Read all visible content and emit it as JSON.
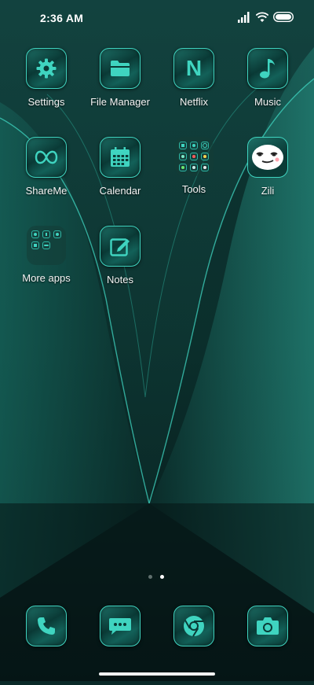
{
  "status": {
    "time": "2:36 AM"
  },
  "apps": {
    "settings": "Settings",
    "file_manager": "File Manager",
    "netflix": "Netflix",
    "music": "Music",
    "shareme": "ShareMe",
    "calendar": "Calendar",
    "tools": "Tools",
    "zili": "Zili",
    "more_apps": "More apps",
    "notes": "Notes"
  },
  "icons": {
    "netflix_glyph": "N",
    "shareme_glyph": "∞"
  },
  "pager": {
    "pages": 2,
    "current": 2
  },
  "colors": {
    "accent": "#3fd4c0",
    "icon_bg": "#0a3a36",
    "background": "#0a2a28"
  }
}
